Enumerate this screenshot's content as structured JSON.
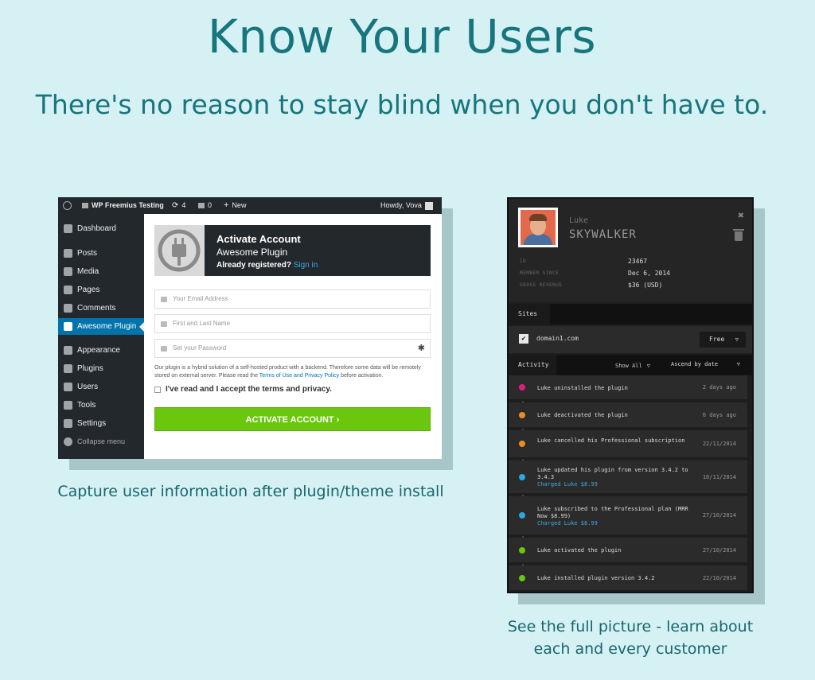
{
  "hero": {
    "title": "Know Your Users",
    "subtitle": "There's no reason to stay blind when you don't have to."
  },
  "captions": {
    "left": "Capture user information after plugin/theme install",
    "right_line1": "See the full picture - learn about",
    "right_line2": "each and every customer"
  },
  "wp": {
    "topbar": {
      "site": "WP Freemius Testing",
      "updates": "4",
      "comments": "0",
      "new": "New",
      "howdy": "Howdy, Vova"
    },
    "menu": [
      "Dashboard",
      "Posts",
      "Media",
      "Pages",
      "Comments",
      "Awesome Plugin",
      "Appearance",
      "Plugins",
      "Users",
      "Tools",
      "Settings",
      "Collapse menu"
    ],
    "activate": {
      "title": "Activate Account",
      "plugin": "Awesome Plugin",
      "registered": "Already registered?",
      "sign_in": "Sign in"
    },
    "fields": {
      "email": "Your Email Address",
      "name": "First and Last Name",
      "password": "Set your Password"
    },
    "note_a": "Our plugin is a hybrid solution of a self-hosted product with a backend. Therefore some data will be remotely stored on external server. Please read the",
    "note_link": "Terms of Use and Privacy Policy",
    "note_b": "before activation.",
    "accept": "I've read and I accept the terms and privacy.",
    "button": "ACTIVATE ACCOUNT ›"
  },
  "panel": {
    "first": "Luke",
    "last": "SKYWALKER",
    "meta": [
      {
        "k": "ID",
        "v": "23467"
      },
      {
        "k": "MEMBER SINCE",
        "v": "Dec 6, 2014"
      },
      {
        "k": "GROSS REVENUE",
        "v": "$36 (USD)"
      }
    ],
    "sites_label": "Sites",
    "site": "domain1.com",
    "plan": "Free",
    "activity_label": "Activity",
    "filter": "Show All",
    "sort": "Ascend by date",
    "events": [
      {
        "text": "Luke uninstalled the plugin",
        "charge": "",
        "time": "2 days ago",
        "color": "#e5197d"
      },
      {
        "text": "Luke deactivated the plugin",
        "charge": "",
        "time": "6 days ago",
        "color": "#f08a24"
      },
      {
        "text": "Luke cancelled his Professional subscription",
        "charge": "",
        "time": "22/11/2014",
        "color": "#f08a24"
      },
      {
        "text": "Luke updated his plugin from version 3.4.2 to 3.4.3",
        "charge": "Charged Luke $8.99",
        "time": "10/11/2014",
        "color": "#29a9e1"
      },
      {
        "text": "Luke subscribed to the Professional plan (MRR Now $8.99)",
        "charge": "Charged Luke $8.99",
        "time": "27/10/2014",
        "color": "#29a9e1"
      },
      {
        "text": "Luke activated the plugin",
        "charge": "",
        "time": "27/10/2014",
        "color": "#6ac70e"
      },
      {
        "text": "Luke installed plugin version 3.4.2",
        "charge": "",
        "time": "22/10/2014",
        "color": "#6ac70e"
      }
    ]
  }
}
